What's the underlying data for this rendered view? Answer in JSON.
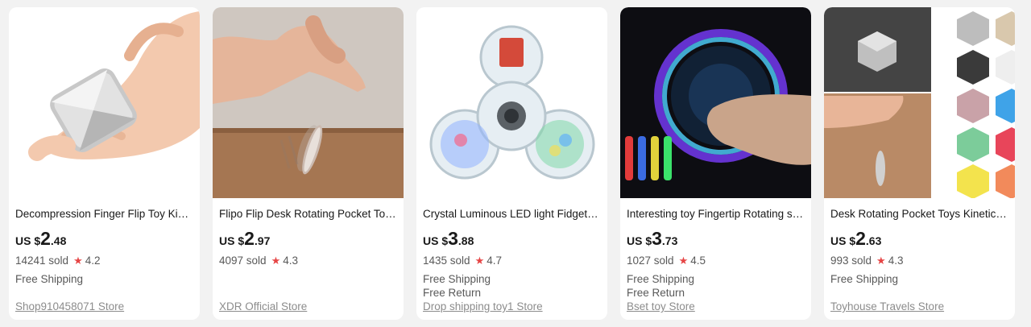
{
  "products": [
    {
      "title": "Decompression Finger Flip Toy Kinetic Desk Toy",
      "title_display": "Decompression Finger Flip Toy Kin…",
      "currency": "US $",
      "price_int": "2",
      "price_dec": ".48",
      "sold": "14241 sold",
      "rating": "4.2",
      "shipping": [
        "Free Shipping"
      ],
      "store": "Shop910458071 Store"
    },
    {
      "title": "Flipo Flip Desk Rotating Pocket Toys",
      "title_display": "Flipo Flip Desk Rotating Pocket Toy…",
      "currency": "US $",
      "price_int": "2",
      "price_dec": ".97",
      "sold": "4097 sold",
      "rating": "4.3",
      "shipping": [],
      "store": "XDR Official Store"
    },
    {
      "title": "Crystal Luminous LED light Fidget Spinner",
      "title_display": "Crystal Luminous LED light Fidget …",
      "currency": "US $",
      "price_int": "3",
      "price_dec": ".88",
      "sold": "1435 sold",
      "rating": "4.7",
      "shipping": [
        "Free Shipping",
        "Free Return"
      ],
      "store": "Drop shipping toy1 Store"
    },
    {
      "title": "Interesting toy Fingertip Rotating spinner",
      "title_display": "Interesting toy Fingertip Rotating s…",
      "currency": "US $",
      "price_int": "3",
      "price_dec": ".73",
      "sold": "1027 sold",
      "rating": "4.5",
      "shipping": [
        "Free Shipping",
        "Free Return"
      ],
      "store": "Bset toy Store"
    },
    {
      "title": "Desk Rotating Pocket Toys Kinetic Desk Toy",
      "title_display": "Desk Rotating Pocket Toys Kinetic …",
      "currency": "US $",
      "price_int": "2",
      "price_dec": ".63",
      "sold": "993 sold",
      "rating": "4.3",
      "shipping": [
        "Free Shipping"
      ],
      "store": "Toyhouse Travels Store"
    }
  ],
  "colors": {
    "star": "#e64545",
    "text": "#191919",
    "muted": "#595959",
    "store": "#8c8c8c"
  }
}
